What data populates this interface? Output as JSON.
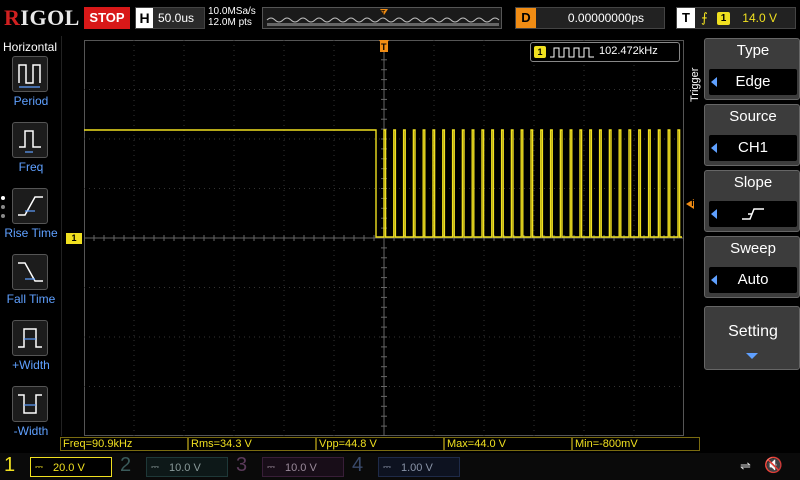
{
  "brand": {
    "name_r": "R",
    "name_rest": "IGOL"
  },
  "run_state": "STOP",
  "horizontal": {
    "label": "H",
    "timebase": "50.0us"
  },
  "acquisition": {
    "sample_rate": "10.0MSa/s",
    "points": "12.0M pts"
  },
  "delay": {
    "label": "D",
    "value": "0.00000000ps"
  },
  "trigger_top": {
    "label": "T",
    "source_num": "1",
    "level": "14.0 V"
  },
  "left_menu": {
    "title": "Horizontal",
    "items": [
      {
        "label": "Period",
        "icon": "period-icon"
      },
      {
        "label": "Freq",
        "icon": "freq-icon"
      },
      {
        "label": "Rise Time",
        "icon": "rise-time-icon"
      },
      {
        "label": "Fall Time",
        "icon": "fall-time-icon"
      },
      {
        "label": "+Width",
        "icon": "positive-width-icon"
      },
      {
        "label": "-Width",
        "icon": "negative-width-icon"
      }
    ]
  },
  "freq_counter": {
    "channel": "1",
    "value": "102.472kHz"
  },
  "right_menu": {
    "section_label": "Trigger",
    "type": {
      "title": "Type",
      "value": "Edge"
    },
    "source": {
      "title": "Source",
      "value": "CH1"
    },
    "slope": {
      "title": "Slope",
      "value_icon": "rising-edge-icon"
    },
    "sweep": {
      "title": "Sweep",
      "value": "Auto"
    },
    "setting": {
      "title": "Setting"
    }
  },
  "measurements": [
    {
      "label": "Freq=90.9kHz"
    },
    {
      "label": "Rms=34.3 V"
    },
    {
      "label": "Vpp=44.8 V"
    },
    {
      "label": "Max=44.0 V"
    },
    {
      "label": "Min=-800mV"
    }
  ],
  "channels": [
    {
      "num": "1",
      "scale": "20.0 V",
      "color": "#f0e020",
      "active": true
    },
    {
      "num": "2",
      "scale": "10.0 V",
      "color": "#20a0a0",
      "active": false
    },
    {
      "num": "3",
      "scale": "10.0 V",
      "color": "#c040c0",
      "active": false
    },
    {
      "num": "4",
      "scale": "1.00 V",
      "color": "#3070d0",
      "active": false
    }
  ],
  "colors": {
    "ch1": "#f0e020",
    "trigger_marker": "#f08c14",
    "menu_accent": "#5fa0ff"
  }
}
